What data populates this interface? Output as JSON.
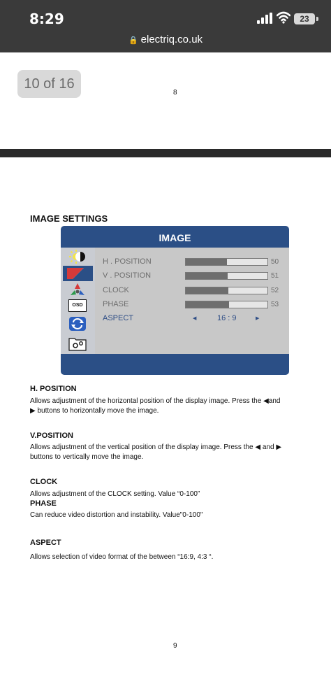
{
  "status_bar": {
    "time": "8:29",
    "battery": "23",
    "url": "electriq.co.uk"
  },
  "page_indicator": "10 of 16",
  "page_numbers": {
    "top": "8",
    "bottom": "9"
  },
  "section_title": "IMAGE SETTINGS",
  "osd": {
    "title": "IMAGE",
    "icons": [
      "brightness-contrast-icon",
      "image-icon",
      "color-icon",
      "osd-icon",
      "reset-icon",
      "settings-folder-icon"
    ],
    "osd_icon_text": "OSD",
    "rows": [
      {
        "label": "H . POSITION",
        "value": "50",
        "level": 0.5
      },
      {
        "label": "V . POSITION",
        "value": "51",
        "level": 0.51
      },
      {
        "label": "CLOCK",
        "value": "52",
        "level": 0.52
      },
      {
        "label": "PHASE",
        "value": "53",
        "level": 0.53
      }
    ],
    "aspect": {
      "label": "ASPECT",
      "value": "16 : 9"
    }
  },
  "descriptions": {
    "h_position": {
      "title": "H. POSITION",
      "line1": "Allows adjustment of the horizontal position of the display image. Press the ◀and",
      "line2": "▶ buttons to horizontally move the image."
    },
    "v_position": {
      "title": "V.POSITION",
      "line1": "Allows adjustment of the vertical position of the display image. Press the ◀ and ▶",
      "line2": "buttons to vertically move the image."
    },
    "clock": {
      "title": "CLOCK",
      "text": "Allows adjustment of the CLOCK setting. Value “0-100”"
    },
    "phase": {
      "title": "PHASE",
      "text": "Can reduce video distortion and instability. Value\"0-100\""
    },
    "aspect": {
      "title": "ASPECT",
      "text": "Allows selection of video format of the between “16:9, 4:3 “."
    }
  }
}
